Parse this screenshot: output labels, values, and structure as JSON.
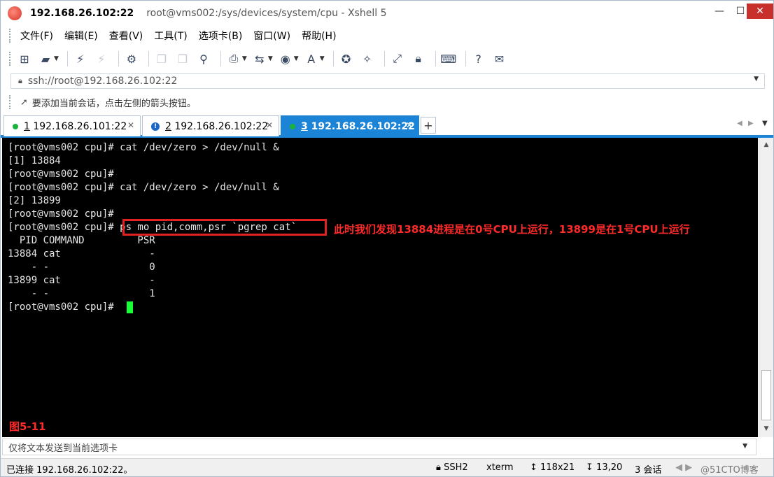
{
  "window": {
    "title_host": "192.168.26.102:22",
    "title_rest": "root@vms002:/sys/devices/system/cpu - Xshell 5"
  },
  "menu": {
    "items": [
      "文件(F)",
      "编辑(E)",
      "查看(V)",
      "工具(T)",
      "选项卡(B)",
      "窗口(W)",
      "帮助(H)"
    ]
  },
  "toolbar": {
    "icons": [
      "new-session-icon",
      "open-folder-icon",
      "connect-icon",
      "disconnect-icon",
      "properties-icon",
      "copy-icon",
      "paste-icon",
      "find-icon",
      "print-icon",
      "transfer-icon",
      "globe-icon",
      "font-icon",
      "xftp-icon",
      "xmanager-icon",
      "fullscreen-icon",
      "lock-icon",
      "keyboard-icon",
      "help-icon",
      "chat-icon"
    ]
  },
  "address": {
    "value": "ssh://root@192.168.26.102:22"
  },
  "hint": {
    "text": "要添加当前会话，点击左侧的箭头按钮。"
  },
  "tabs": [
    {
      "num": "1",
      "label": " 192.168.26.101:22",
      "status": "green"
    },
    {
      "num": "2",
      "label": " 192.168.26.102:22",
      "status": "info"
    },
    {
      "num": "3",
      "label": " 192.168.26.102:22",
      "status": "green",
      "active": true
    }
  ],
  "terminal": {
    "lines": [
      "[root@vms002 cpu]# cat /dev/zero > /dev/null &",
      "[1] 13884",
      "[root@vms002 cpu]#",
      "[root@vms002 cpu]# cat /dev/zero > /dev/null &",
      "[2] 13899",
      "[root@vms002 cpu]#",
      "[root@vms002 cpu]# ps mo pid,comm,psr `pgrep cat`",
      "  PID COMMAND         PSR",
      "13884 cat               -",
      "    - -                 0",
      "13899 cat               -",
      "    - -                 1",
      "[root@vms002 cpu]# "
    ],
    "annotation": "此时我们发现13884进程是在0号CPU上运行，13899是在1号CPU上运行",
    "figure_label": "图5-11"
  },
  "sendbar": {
    "text": "仅将文本发送到当前选项卡"
  },
  "status": {
    "connected": "已连接 192.168.26.102:22。",
    "protocol": "SSH2",
    "term": "xterm",
    "size": "118x21",
    "cursor": "13,20",
    "sessions": "3 会话",
    "watermark": "@51CTO博客"
  },
  "colors": {
    "accent": "#1b84d6",
    "annotation": "#ff2a2a",
    "cursor": "#17ff38",
    "terminal_bg": "#000000"
  }
}
